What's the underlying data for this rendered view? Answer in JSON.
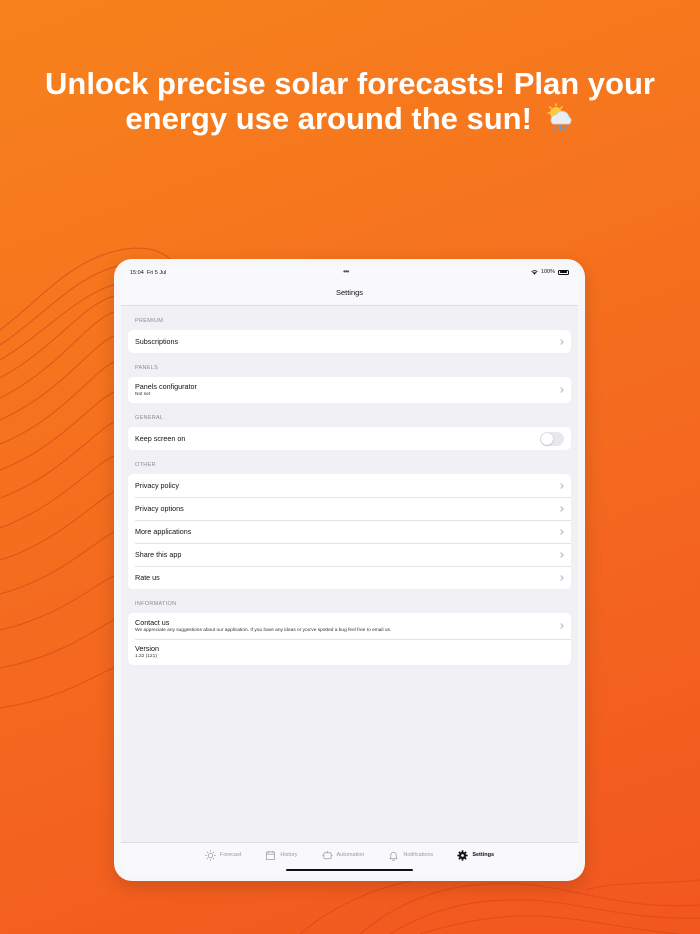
{
  "headline": {
    "line1": "Unlock precise solar forecasts! Plan your",
    "line2": "energy use around the sun!"
  },
  "status_bar": {
    "time": "15:04",
    "date": "Fri 5 Jul",
    "battery": "100%"
  },
  "nav": {
    "title": "Settings"
  },
  "sections": {
    "premium": {
      "header": "PREMIUM",
      "subscriptions": "Subscriptions"
    },
    "panels": {
      "header": "PANELS",
      "configurator": "Panels configurator",
      "configurator_value": "Not set"
    },
    "general": {
      "header": "GENERAL",
      "keep_screen_on": "Keep screen on",
      "keep_screen_on_enabled": false
    },
    "other": {
      "header": "OTHER",
      "privacy_policy": "Privacy policy",
      "privacy_options": "Privacy options",
      "more_applications": "More applications",
      "share_app": "Share this app",
      "rate_us": "Rate us"
    },
    "information": {
      "header": "INFORMATION",
      "contact_us": "Contact us",
      "contact_us_sub": "We appreciate any suggestions about our application. If you have any ideas or you've spotted a bug feel free to email us.",
      "version": "Version",
      "version_value": "1.22 (121)"
    }
  },
  "tabs": {
    "forecast": "Forecast",
    "history": "History",
    "automation": "Automation",
    "notifications": "Notifications",
    "settings": "Settings",
    "active": "settings"
  },
  "colors": {
    "background_start": "#f7821c",
    "background_end": "#f2561f",
    "accent": "#111111"
  },
  "icons": [
    "sun-icon",
    "calendar-icon",
    "automation-icon",
    "bell-icon",
    "gear-icon",
    "chevron-right-icon",
    "sun-behind-rain-cloud-icon",
    "wifi-icon",
    "battery-icon"
  ]
}
